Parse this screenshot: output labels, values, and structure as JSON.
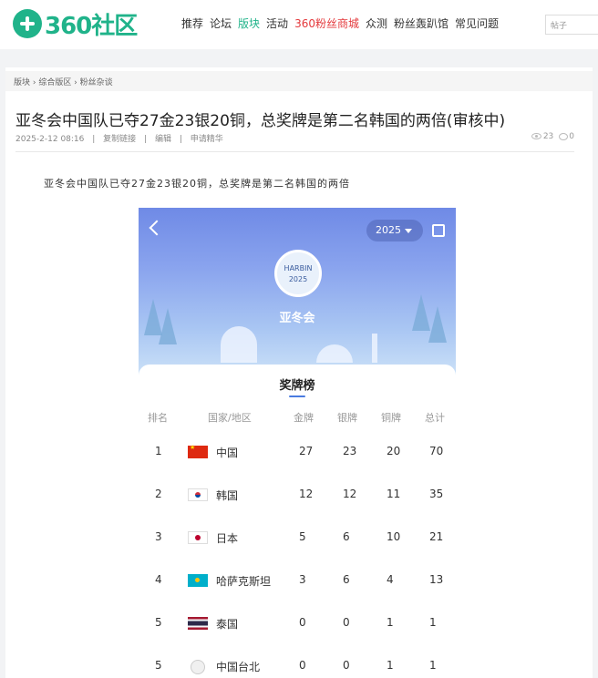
{
  "site": {
    "logo_text": "360社区",
    "nav": [
      "推荐",
      "论坛",
      "版块",
      "活动",
      "360粉丝商城",
      "众测",
      "粉丝轰趴馆",
      "常见问题"
    ],
    "search_placeholder": "帖子"
  },
  "breadcrumb": "版块 › 综合版区 › 粉丝杂谈",
  "post": {
    "title": "亚冬会中国队已夺27金23银20铜，总奖牌是第二名韩国的两倍(审核中)",
    "date": "2025-2-12 08:16",
    "actions": [
      "复制链接",
      "编辑",
      "申请精华"
    ],
    "views": "23",
    "comments": "0",
    "lead": "亚冬会中国队已夺27金23银20铜，总奖牌是第二名韩国的两倍"
  },
  "app": {
    "year": "2025",
    "badge_line1": "HARBIN",
    "badge_line2": "2025",
    "banner_label": "亚冬会",
    "sheet_title": "奖牌榜",
    "headers": [
      "排名",
      "国家/地区",
      "金牌",
      "银牌",
      "铜牌",
      "总计"
    ],
    "rows": [
      {
        "rank": "1",
        "name": "中国",
        "gold": "27",
        "silver": "23",
        "bronze": "20",
        "total": "70",
        "flag": "cn"
      },
      {
        "rank": "2",
        "name": "韩国",
        "gold": "12",
        "silver": "12",
        "bronze": "11",
        "total": "35",
        "flag": "kr"
      },
      {
        "rank": "3",
        "name": "日本",
        "gold": "5",
        "silver": "6",
        "bronze": "10",
        "total": "21",
        "flag": "jp"
      },
      {
        "rank": "4",
        "name": "哈萨克斯坦",
        "gold": "3",
        "silver": "6",
        "bronze": "4",
        "total": "13",
        "flag": "kz"
      },
      {
        "rank": "5",
        "name": "泰国",
        "gold": "0",
        "silver": "0",
        "bronze": "1",
        "total": "1",
        "flag": "th"
      },
      {
        "rank": "5",
        "name": "中国台北",
        "gold": "0",
        "silver": "0",
        "bronze": "1",
        "total": "1",
        "flag": "tpe"
      }
    ]
  }
}
